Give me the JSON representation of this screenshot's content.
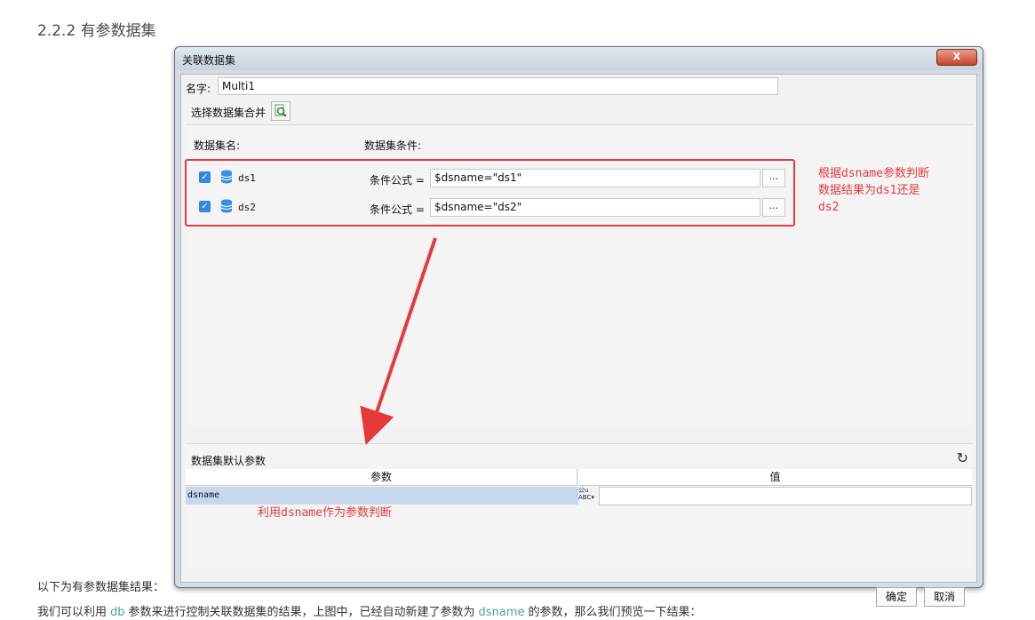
{
  "doc": {
    "section_title": "2.2.2 有参数据集",
    "result_intro": "以下为有参数据集结果：",
    "explain": {
      "part1": "我们可以利用",
      "db": "db",
      "part2": "参数来进行控制关联数据集的结果，上图中，已经自动新建了参数为",
      "dsname": "dsname",
      "part3": "的参数，那么我们预览一下结果："
    }
  },
  "dialog": {
    "title": "关联数据集",
    "close_label": "x",
    "name_label": "名字:",
    "name_value": "Multi1",
    "merge_label": "选择数据集合并",
    "header_dataset_name": "数据集名:",
    "header_condition": "数据集条件:",
    "rows": [
      {
        "name": "ds1",
        "cond_label": "条件公式 =",
        "cond_value": "$dsname=\"ds1\"",
        "dots": "..."
      },
      {
        "name": "ds2",
        "cond_label": "条件公式 =",
        "cond_value": "$dsname=\"ds2\"",
        "dots": "..."
      }
    ],
    "params_title": "数据集默认参数",
    "col_param": "参数",
    "col_value": "值",
    "param_name": "dsname",
    "ok": "确定",
    "cancel": "取消"
  },
  "annotations": {
    "right_note_line1": "根据dsname参数判断",
    "right_note_line2": "数据结果为ds1还是",
    "right_note_line3": "ds2",
    "bottom_note": "利用dsname作为参数判断"
  },
  "colors": {
    "annotation_red": "#e63a3a",
    "checkbox_blue": "#2f8be0",
    "param_row_highlight": "#c7d8ee"
  }
}
